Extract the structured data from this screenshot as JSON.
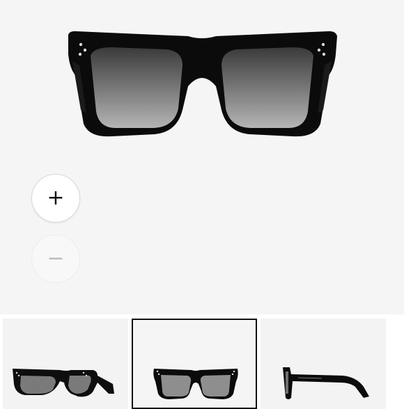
{
  "product": {
    "main_image_icon": "sunglasses-front-view",
    "frame_color": "#0b0b0b",
    "lens_color_top": "#3d3d3d",
    "lens_color_bottom": "#a9a9a9"
  },
  "zoom": {
    "in_label": "+",
    "out_label": "−"
  },
  "thumbnails": [
    {
      "view": "angle-view",
      "selected": false
    },
    {
      "view": "front-view",
      "selected": true
    },
    {
      "view": "side-view",
      "selected": false
    }
  ]
}
